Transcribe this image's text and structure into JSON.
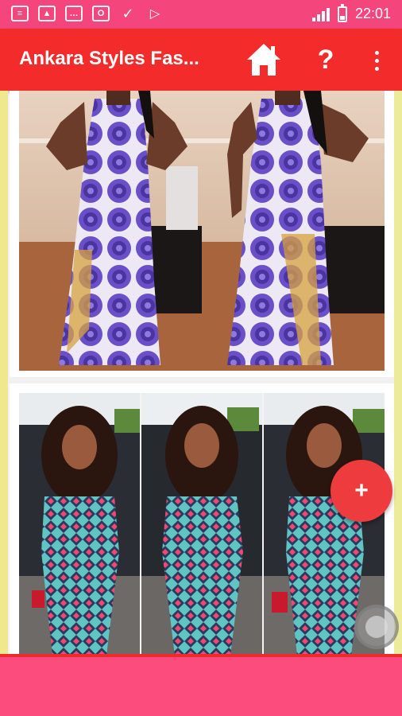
{
  "status_bar": {
    "time": "22:01",
    "left_icons": [
      "message-icon",
      "image-icon",
      "chat-icon",
      "office-icon",
      "checklist-icon",
      "play-store-icon"
    ]
  },
  "app_bar": {
    "title": "Ankara Styles Fas...",
    "help_label": "?",
    "home_icon": "home-icon",
    "menu_icon": "more-vert-icon"
  },
  "gallery": {
    "items": [
      {
        "alt": "Purple and white Ankara print gown, two views"
      },
      {
        "alt": "Turquoise patterned Ankara jumpsuit, three views"
      }
    ]
  },
  "fab": {
    "label": "+"
  },
  "colors": {
    "status_bar": "#f4467c",
    "app_bar": "#f32b2b",
    "bottom_bar": "#fb4c7d",
    "fab": "#ee3b3e"
  }
}
